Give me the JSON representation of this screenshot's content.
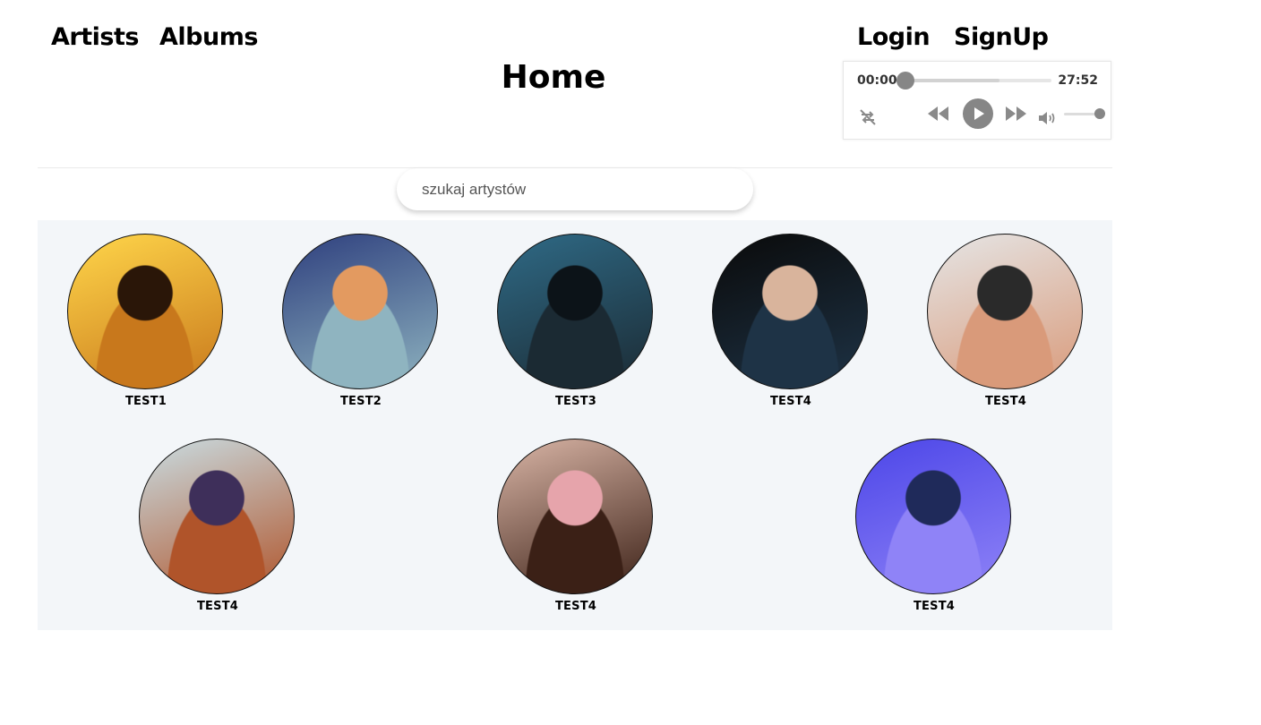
{
  "nav": {
    "artists": "Artists",
    "albums": "Albums",
    "login": "Login",
    "signup": "SignUp"
  },
  "page": {
    "title": "Home"
  },
  "player": {
    "current_time": "00:00",
    "duration": "27:52",
    "progress": 0,
    "buffered": 0.64,
    "volume": 1.0,
    "icons": [
      "loop-icon",
      "rewind-icon",
      "play-icon",
      "fast-forward-icon",
      "volume-icon"
    ]
  },
  "search": {
    "placeholder": "szukaj artystów",
    "value": ""
  },
  "artists": [
    {
      "name": "TEST1",
      "colors": [
        "#ffd64a",
        "#c8781c",
        "#2a1608"
      ]
    },
    {
      "name": "TEST2",
      "colors": [
        "#2e3f7e",
        "#8fb4c0",
        "#e39a60"
      ]
    },
    {
      "name": "TEST3",
      "colors": [
        "#2f6a86",
        "#1b2a33",
        "#0c1318"
      ]
    },
    {
      "name": "TEST4",
      "colors": [
        "#0a0a0a",
        "#1e3346",
        "#d9b49c"
      ]
    },
    {
      "name": "TEST4",
      "colors": [
        "#e5e5e5",
        "#d99a7a",
        "#2a2a2a"
      ]
    },
    {
      "name": "TEST4",
      "colors": [
        "#c9dde3",
        "#b0542a",
        "#3e2f5a"
      ]
    },
    {
      "name": "TEST4",
      "colors": [
        "#d9b5a6",
        "#3b2016",
        "#e6a4ab"
      ]
    },
    {
      "name": "TEST4",
      "colors": [
        "#4c46e8",
        "#8f83f7",
        "#1f2a5a"
      ]
    }
  ],
  "colors": {
    "accent": "#868686",
    "grid_bg": "#f3f6f9"
  }
}
